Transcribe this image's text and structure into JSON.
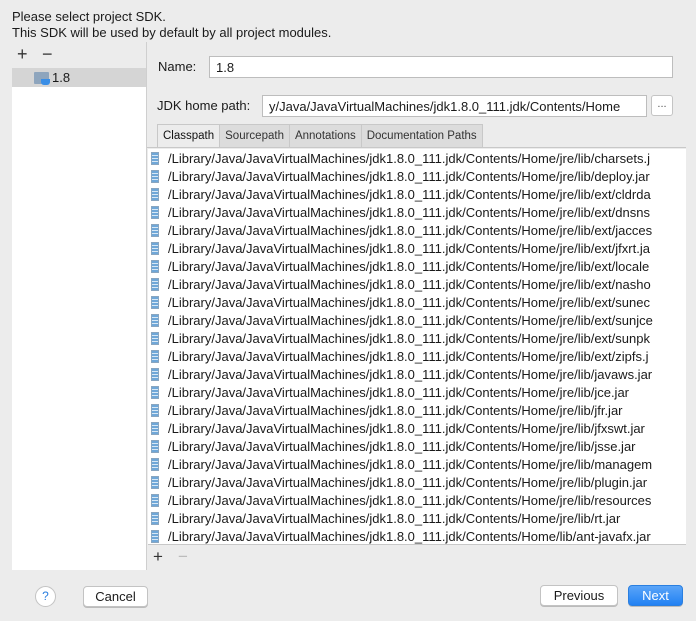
{
  "intro": {
    "line1": "Please select project SDK.",
    "line2": "This SDK will be used by default by all project modules."
  },
  "sdk_toolbar": {
    "add": "+",
    "remove": "−"
  },
  "sdk_list": [
    {
      "label": "1.8",
      "icon": "jdk-folder-icon"
    }
  ],
  "name_label": "Name:",
  "name_value": "1.8",
  "home_label": "JDK home path:",
  "home_value": "y/Java/JavaVirtualMachines/jdk1.8.0_111.jdk/Contents/Home",
  "browse_label": "...",
  "tabs": [
    {
      "label": "Classpath",
      "active": true
    },
    {
      "label": "Sourcepath"
    },
    {
      "label": "Annotations"
    },
    {
      "label": "Documentation Paths"
    }
  ],
  "classpath": [
    "/Library/Java/JavaVirtualMachines/jdk1.8.0_111.jdk/Contents/Home/jre/lib/charsets.j",
    "/Library/Java/JavaVirtualMachines/jdk1.8.0_111.jdk/Contents/Home/jre/lib/deploy.jar",
    "/Library/Java/JavaVirtualMachines/jdk1.8.0_111.jdk/Contents/Home/jre/lib/ext/cldrda",
    "/Library/Java/JavaVirtualMachines/jdk1.8.0_111.jdk/Contents/Home/jre/lib/ext/dnsns",
    "/Library/Java/JavaVirtualMachines/jdk1.8.0_111.jdk/Contents/Home/jre/lib/ext/jacces",
    "/Library/Java/JavaVirtualMachines/jdk1.8.0_111.jdk/Contents/Home/jre/lib/ext/jfxrt.ja",
    "/Library/Java/JavaVirtualMachines/jdk1.8.0_111.jdk/Contents/Home/jre/lib/ext/locale",
    "/Library/Java/JavaVirtualMachines/jdk1.8.0_111.jdk/Contents/Home/jre/lib/ext/nasho",
    "/Library/Java/JavaVirtualMachines/jdk1.8.0_111.jdk/Contents/Home/jre/lib/ext/sunec",
    "/Library/Java/JavaVirtualMachines/jdk1.8.0_111.jdk/Contents/Home/jre/lib/ext/sunjce",
    "/Library/Java/JavaVirtualMachines/jdk1.8.0_111.jdk/Contents/Home/jre/lib/ext/sunpk",
    "/Library/Java/JavaVirtualMachines/jdk1.8.0_111.jdk/Contents/Home/jre/lib/ext/zipfs.j",
    "/Library/Java/JavaVirtualMachines/jdk1.8.0_111.jdk/Contents/Home/jre/lib/javaws.jar",
    "/Library/Java/JavaVirtualMachines/jdk1.8.0_111.jdk/Contents/Home/jre/lib/jce.jar",
    "/Library/Java/JavaVirtualMachines/jdk1.8.0_111.jdk/Contents/Home/jre/lib/jfr.jar",
    "/Library/Java/JavaVirtualMachines/jdk1.8.0_111.jdk/Contents/Home/jre/lib/jfxswt.jar",
    "/Library/Java/JavaVirtualMachines/jdk1.8.0_111.jdk/Contents/Home/jre/lib/jsse.jar",
    "/Library/Java/JavaVirtualMachines/jdk1.8.0_111.jdk/Contents/Home/jre/lib/managem",
    "/Library/Java/JavaVirtualMachines/jdk1.8.0_111.jdk/Contents/Home/jre/lib/plugin.jar",
    "/Library/Java/JavaVirtualMachines/jdk1.8.0_111.jdk/Contents/Home/jre/lib/resources",
    "/Library/Java/JavaVirtualMachines/jdk1.8.0_111.jdk/Contents/Home/jre/lib/rt.jar",
    "/Library/Java/JavaVirtualMachines/jdk1.8.0_111.jdk/Contents/Home/lib/ant-javafx.jar"
  ],
  "path_toolbar": {
    "add": "+",
    "remove": "−"
  },
  "footer": {
    "help": "?",
    "cancel": "Cancel",
    "previous": "Previous",
    "next": "Next"
  },
  "colors": {
    "accent": "#2281f3",
    "selection": "#d5d5d5"
  }
}
